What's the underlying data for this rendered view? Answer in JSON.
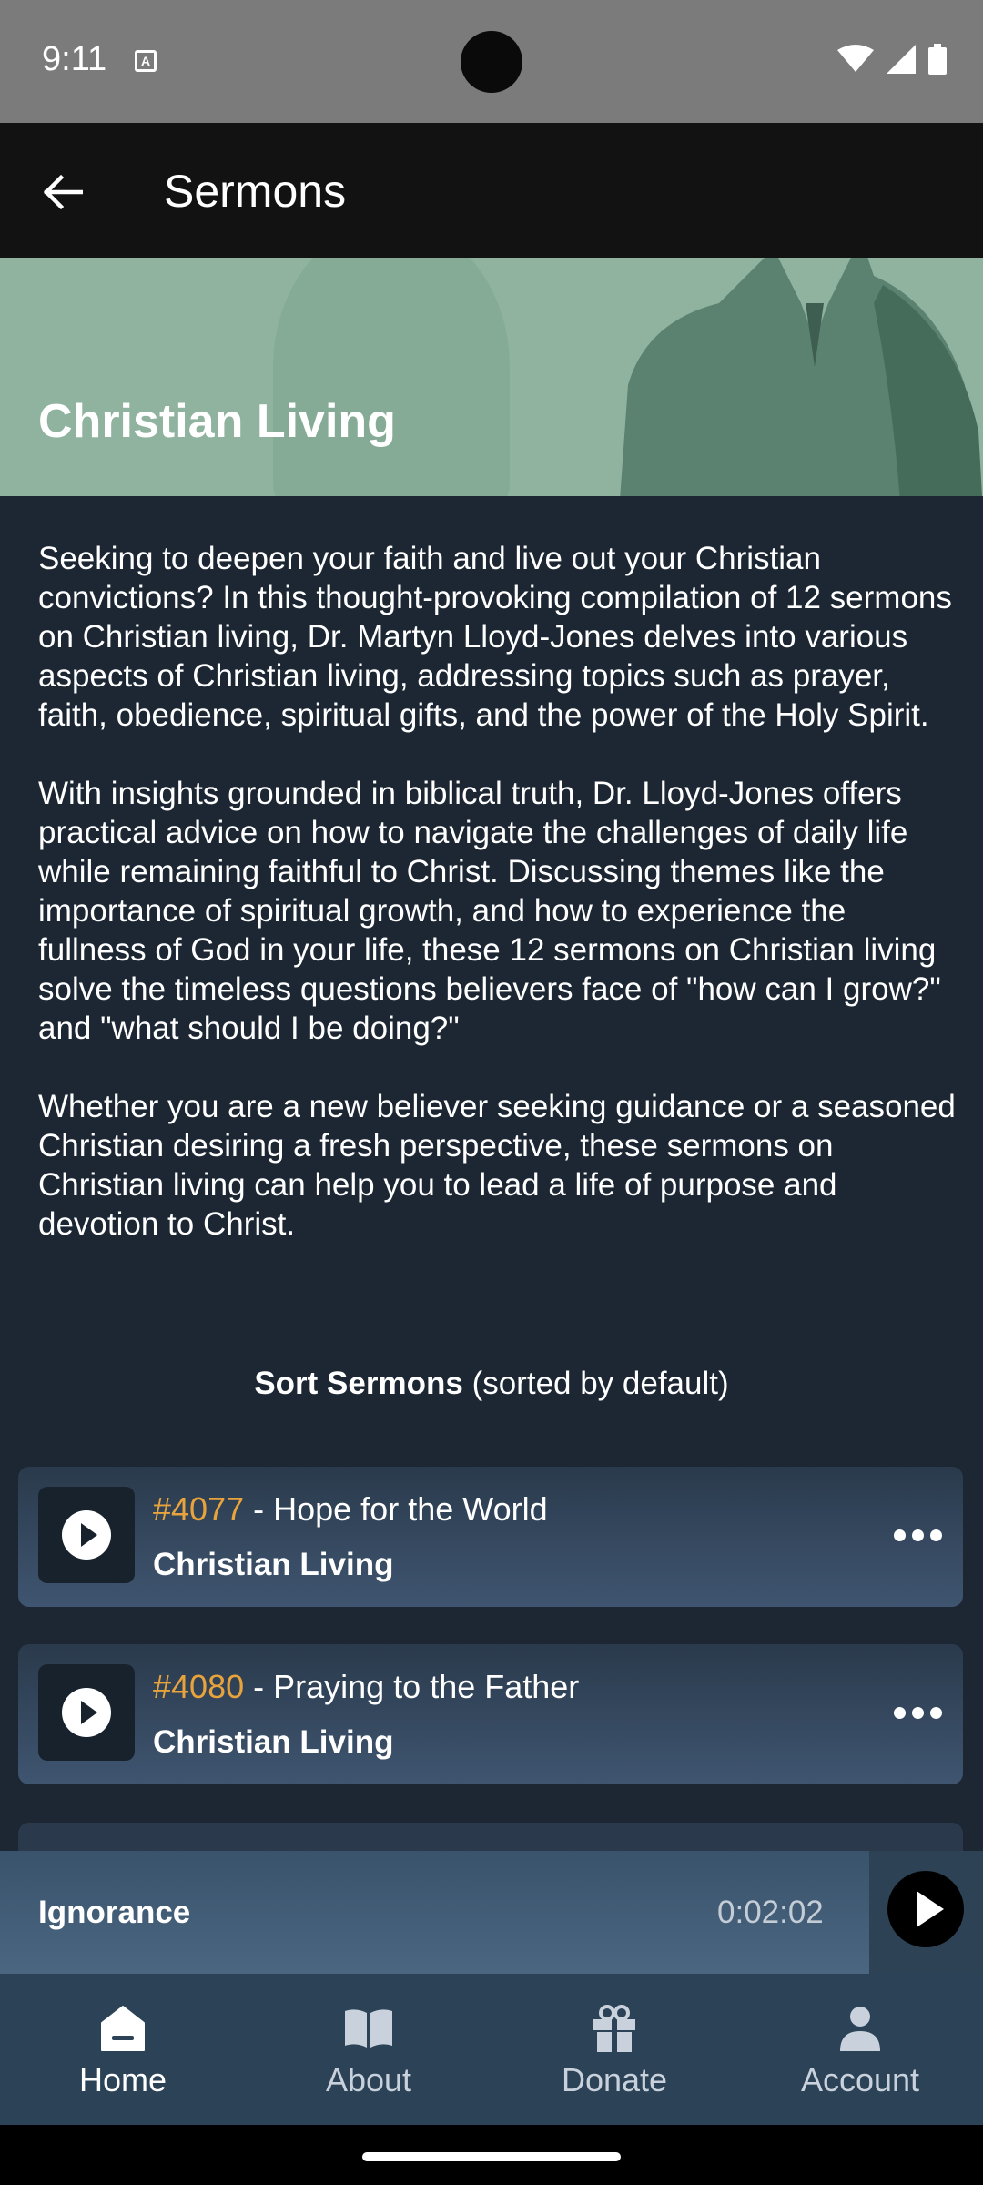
{
  "status_bar": {
    "time": "9:11"
  },
  "app_bar": {
    "title": "Sermons"
  },
  "hero": {
    "title": "Christian Living"
  },
  "description": [
    "Seeking to deepen your faith and live out your Christian convictions? In this thought-provoking compilation of 12 sermons on Christian living, Dr. Martyn Lloyd-Jones delves into various aspects of Christian living, addressing topics such as prayer, faith, obedience, spiritual gifts, and the power of the Holy Spirit.",
    "With insights grounded in biblical truth, Dr. Lloyd-Jones offers practical advice on how to navigate the challenges of daily life while remaining faithful to Christ. Discussing themes like the importance of spiritual growth, and how to experience the fullness of God in your life, these 12 sermons on Christian living solve the timeless questions believers face of \"how can I grow?\" and \"what should I be doing?\"",
    "Whether you are a new believer seeking guidance or a seasoned Christian desiring a fresh perspective, these sermons on Christian living can help you to lead a life of purpose and devotion to Christ."
  ],
  "sort": {
    "label": "Sort Sermons",
    "note": "(sorted by default)"
  },
  "sermons": [
    {
      "number": "#4077",
      "separator": " - ",
      "title": "Hope for the World",
      "series": "Christian Living"
    },
    {
      "number": "#4080",
      "separator": " - ",
      "title": "Praying to the Father",
      "series": "Christian Living"
    }
  ],
  "now_playing": {
    "title": "Ignorance",
    "time": "0:02:02"
  },
  "nav": [
    {
      "label": "Home",
      "icon": "home-icon",
      "active": true
    },
    {
      "label": "About",
      "icon": "book-icon",
      "active": false
    },
    {
      "label": "Donate",
      "icon": "gift-icon",
      "active": false
    },
    {
      "label": "Account",
      "icon": "person-icon",
      "active": false
    }
  ],
  "colors": {
    "accent_number": "#e8a33c",
    "background": "#1c2733",
    "nav_bg": "#2b4257"
  }
}
